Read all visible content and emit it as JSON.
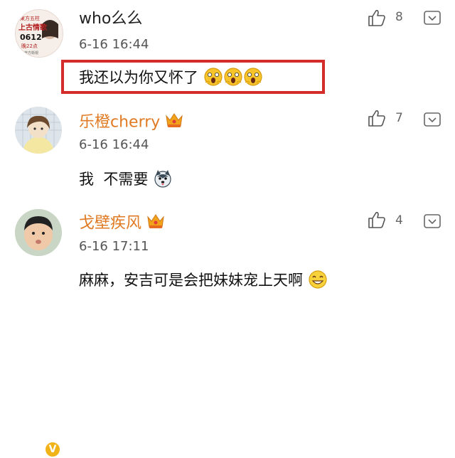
{
  "comments": [
    {
      "username": "who么么",
      "time": "6-16 16:44",
      "text": "我还以为你又怀了",
      "likes": "8",
      "avatar_text": [
        "東方五柱",
        "上古情歌",
        "0612",
        "晚22点",
        "東方衛視"
      ],
      "vip": false
    },
    {
      "username": "乐橙cherry",
      "time": "6-16 16:44",
      "text": "我  不需要",
      "likes": "7",
      "vip": true
    },
    {
      "username": "戈壁疾风",
      "time": "6-16 17:11",
      "text": "麻麻，安吉可是会把妹妹宠上天啊",
      "likes": "4",
      "vip": true,
      "verified_mark": "V"
    }
  ],
  "colors": {
    "vip_name": "#e07a23",
    "highlight_border": "#d42b2b",
    "verified_badge": "#f2b318"
  }
}
